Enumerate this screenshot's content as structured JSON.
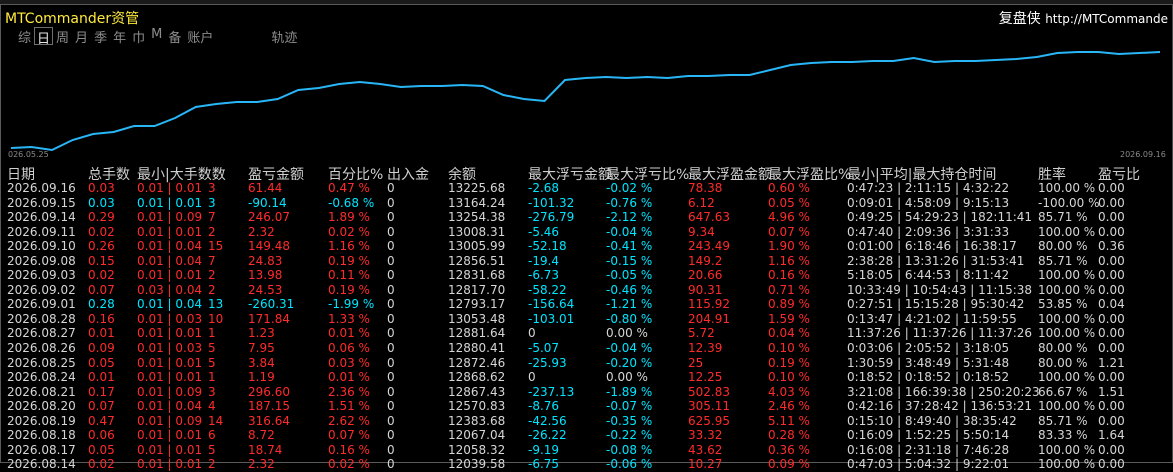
{
  "app": {
    "title": "MTCommander资管",
    "brand": "复盘侠",
    "url": "http://MTCommande"
  },
  "tabs": [
    "综",
    "日",
    "周",
    "月",
    "季",
    "年",
    "巾",
    "M",
    "备",
    "账户",
    "轨迹"
  ],
  "active_tab_index": 1,
  "chart": {
    "start_label": "026.05.25",
    "end_label": "2026.09.16",
    "line_color": "#29b6f6",
    "values": [
      0.02,
      0.03,
      0.0,
      0.1,
      0.16,
      0.18,
      0.24,
      0.24,
      0.32,
      0.43,
      0.46,
      0.48,
      0.48,
      0.51,
      0.6,
      0.62,
      0.66,
      0.68,
      0.66,
      0.63,
      0.64,
      0.64,
      0.65,
      0.64,
      0.55,
      0.51,
      0.49,
      0.7,
      0.72,
      0.73,
      0.72,
      0.73,
      0.72,
      0.74,
      0.74,
      0.75,
      0.75,
      0.8,
      0.85,
      0.87,
      0.88,
      0.88,
      0.89,
      0.89,
      0.92,
      0.88,
      0.89,
      0.89,
      0.9,
      0.91,
      0.93,
      0.97,
      0.98,
      0.98,
      0.96,
      0.97,
      0.98
    ]
  },
  "table": {
    "headers": [
      "日期",
      "总手数",
      "最小|大手数数",
      "盈亏金额",
      "百分比%",
      "出入金",
      "余额",
      "最大浮亏金额",
      "最大浮亏比%",
      "最大浮盈金额",
      "最大浮盈比%",
      "最小|平均|最大持仓时间",
      "胜率",
      "盈亏比"
    ],
    "rows": [
      {
        "date": "2026.09.16",
        "total": "0.03",
        "lots": "0.01 | 0.01",
        "count": "3",
        "pl": "61.44",
        "pct": "0.47 %",
        "inout": "0",
        "balance": "13225.68",
        "float_loss": "-2.68",
        "float_loss_pct": "-0.02 %",
        "float_profit": "78.38",
        "float_profit_pct": "0.60 %",
        "hold": "0:47:23 | 2:11:15 | 4:32:22",
        "win": "100.00 %",
        "ratio": "0.00",
        "sign": "pos"
      },
      {
        "date": "2026.09.15",
        "total": "0.03",
        "lots": "0.01 | 0.01",
        "count": "3",
        "pl": "-90.14",
        "pct": "-0.68 %",
        "inout": "0",
        "balance": "13164.24",
        "float_loss": "-101.32",
        "float_loss_pct": "-0.76 %",
        "float_profit": "6.12",
        "float_profit_pct": "0.05 %",
        "hold": "0:09:01 | 4:58:09 | 9:15:13",
        "win": "-100.00 %",
        "ratio": "0.00",
        "sign": "neg"
      },
      {
        "date": "2026.09.14",
        "total": "0.29",
        "lots": "0.01 | 0.09",
        "count": "7",
        "pl": "246.07",
        "pct": "1.89 %",
        "inout": "0",
        "balance": "13254.38",
        "float_loss": "-276.79",
        "float_loss_pct": "-2.12 %",
        "float_profit": "647.63",
        "float_profit_pct": "4.96 %",
        "hold": "0:49:25 | 54:29:23 | 182:11:41",
        "win": "85.71 %",
        "ratio": "0.00",
        "sign": "pos"
      },
      {
        "date": "2026.09.11",
        "total": "0.02",
        "lots": "0.01 | 0.01",
        "count": "2",
        "pl": "2.32",
        "pct": "0.02 %",
        "inout": "0",
        "balance": "13008.31",
        "float_loss": "-5.46",
        "float_loss_pct": "-0.04 %",
        "float_profit": "9.34",
        "float_profit_pct": "0.07 %",
        "hold": "0:47:40 | 2:09:36 | 3:31:33",
        "win": "100.00 %",
        "ratio": "0.00",
        "sign": "pos"
      },
      {
        "date": "2026.09.10",
        "total": "0.26",
        "lots": "0.01 | 0.04",
        "count": "15",
        "pl": "149.48",
        "pct": "1.16 %",
        "inout": "0",
        "balance": "13005.99",
        "float_loss": "-52.18",
        "float_loss_pct": "-0.41 %",
        "float_profit": "243.49",
        "float_profit_pct": "1.90 %",
        "hold": "0:01:00 | 6:18:46 | 16:38:17",
        "win": "80.00 %",
        "ratio": "0.36",
        "sign": "pos"
      },
      {
        "date": "2026.09.08",
        "total": "0.15",
        "lots": "0.01 | 0.04",
        "count": "7",
        "pl": "24.83",
        "pct": "0.19 %",
        "inout": "0",
        "balance": "12856.51",
        "float_loss": "-19.4",
        "float_loss_pct": "-0.15 %",
        "float_profit": "149.2",
        "float_profit_pct": "1.16 %",
        "hold": "2:38:28 | 13:31:26 | 31:53:41",
        "win": "85.71 %",
        "ratio": "0.00",
        "sign": "pos"
      },
      {
        "date": "2026.09.03",
        "total": "0.02",
        "lots": "0.01 | 0.01",
        "count": "2",
        "pl": "13.98",
        "pct": "0.11 %",
        "inout": "0",
        "balance": "12831.68",
        "float_loss": "-6.73",
        "float_loss_pct": "-0.05 %",
        "float_profit": "20.66",
        "float_profit_pct": "0.16 %",
        "hold": "5:18:05 | 6:44:53 | 8:11:42",
        "win": "100.00 %",
        "ratio": "0.00",
        "sign": "pos"
      },
      {
        "date": "2026.09.02",
        "total": "0.07",
        "lots": "0.03 | 0.04",
        "count": "2",
        "pl": "24.53",
        "pct": "0.19 %",
        "inout": "0",
        "balance": "12817.70",
        "float_loss": "-58.22",
        "float_loss_pct": "-0.46 %",
        "float_profit": "90.31",
        "float_profit_pct": "0.71 %",
        "hold": "10:33:49 | 10:54:43 | 11:15:38",
        "win": "100.00 %",
        "ratio": "0.00",
        "sign": "pos"
      },
      {
        "date": "2026.09.01",
        "total": "0.28",
        "lots": "0.01 | 0.04",
        "count": "13",
        "pl": "-260.31",
        "pct": "-1.99 %",
        "inout": "0",
        "balance": "12793.17",
        "float_loss": "-156.64",
        "float_loss_pct": "-1.21 %",
        "float_profit": "115.92",
        "float_profit_pct": "0.89 %",
        "hold": "0:27:51 | 15:15:28 | 95:30:42",
        "win": "53.85 %",
        "ratio": "0.04",
        "sign": "neg"
      },
      {
        "date": "2026.08.28",
        "total": "0.16",
        "lots": "0.01 | 0.03",
        "count": "10",
        "pl": "171.84",
        "pct": "1.33 %",
        "inout": "0",
        "balance": "13053.48",
        "float_loss": "-103.01",
        "float_loss_pct": "-0.80 %",
        "float_profit": "204.91",
        "float_profit_pct": "1.59 %",
        "hold": "0:13:47 | 4:21:02 | 11:59:55",
        "win": "100.00 %",
        "ratio": "0.00",
        "sign": "pos"
      },
      {
        "date": "2026.08.27",
        "total": "0.01",
        "lots": "0.01 | 0.01",
        "count": "1",
        "pl": "1.23",
        "pct": "0.01 %",
        "inout": "0",
        "balance": "12881.64",
        "float_loss": "0",
        "float_loss_pct": "0.00 %",
        "float_profit": "5.72",
        "float_profit_pct": "0.04 %",
        "hold": "11:37:26 | 11:37:26 | 11:37:26",
        "win": "100.00 %",
        "ratio": "0.00",
        "sign": "pos"
      },
      {
        "date": "2026.08.26",
        "total": "0.09",
        "lots": "0.01 | 0.03",
        "count": "5",
        "pl": "7.95",
        "pct": "0.06 %",
        "inout": "0",
        "balance": "12880.41",
        "float_loss": "-5.07",
        "float_loss_pct": "-0.04 %",
        "float_profit": "12.39",
        "float_profit_pct": "0.10 %",
        "hold": "0:03:06 | 2:05:52 | 3:18:05",
        "win": "80.00 %",
        "ratio": "0.00",
        "sign": "pos"
      },
      {
        "date": "2026.08.25",
        "total": "0.05",
        "lots": "0.01 | 0.01",
        "count": "5",
        "pl": "3.84",
        "pct": "0.03 %",
        "inout": "0",
        "balance": "12872.46",
        "float_loss": "-25.93",
        "float_loss_pct": "-0.20 %",
        "float_profit": "25",
        "float_profit_pct": "0.19 %",
        "hold": "1:30:59 | 3:48:49 | 5:31:48",
        "win": "80.00 %",
        "ratio": "1.21",
        "sign": "pos"
      },
      {
        "date": "2026.08.24",
        "total": "0.01",
        "lots": "0.01 | 0.01",
        "count": "1",
        "pl": "1.19",
        "pct": "0.01 %",
        "inout": "0",
        "balance": "12868.62",
        "float_loss": "0",
        "float_loss_pct": "0.00 %",
        "float_profit": "12.25",
        "float_profit_pct": "0.10 %",
        "hold": "0:18:52 | 0:18:52 | 0:18:52",
        "win": "100.00 %",
        "ratio": "0.00",
        "sign": "pos"
      },
      {
        "date": "2026.08.21",
        "total": "0.17",
        "lots": "0.01 | 0.09",
        "count": "3",
        "pl": "296.60",
        "pct": "2.36 %",
        "inout": "0",
        "balance": "12867.43",
        "float_loss": "-237.13",
        "float_loss_pct": "-1.89 %",
        "float_profit": "502.83",
        "float_profit_pct": "4.03 %",
        "hold": "3:21:08 | 166:39:38 | 250:20:23",
        "win": "66.67 %",
        "ratio": "1.51",
        "sign": "pos"
      },
      {
        "date": "2026.08.20",
        "total": "0.07",
        "lots": "0.01 | 0.04",
        "count": "4",
        "pl": "187.15",
        "pct": "1.51 %",
        "inout": "0",
        "balance": "12570.83",
        "float_loss": "-8.76",
        "float_loss_pct": "-0.07 %",
        "float_profit": "305.11",
        "float_profit_pct": "2.46 %",
        "hold": "0:42:16 | 37:28:42 | 136:53:21",
        "win": "100.00 %",
        "ratio": "0.00",
        "sign": "pos"
      },
      {
        "date": "2026.08.19",
        "total": "0.47",
        "lots": "0.01 | 0.09",
        "count": "14",
        "pl": "316.64",
        "pct": "2.62 %",
        "inout": "0",
        "balance": "12383.68",
        "float_loss": "-42.56",
        "float_loss_pct": "-0.35 %",
        "float_profit": "625.95",
        "float_profit_pct": "5.11 %",
        "hold": "0:15:10 | 8:49:40 | 38:35:42",
        "win": "85.71 %",
        "ratio": "0.00",
        "sign": "pos"
      },
      {
        "date": "2026.08.18",
        "total": "0.06",
        "lots": "0.01 | 0.01",
        "count": "6",
        "pl": "8.72",
        "pct": "0.07 %",
        "inout": "0",
        "balance": "12067.04",
        "float_loss": "-26.22",
        "float_loss_pct": "-0.22 %",
        "float_profit": "33.32",
        "float_profit_pct": "0.28 %",
        "hold": "0:16:09 | 1:52:25 | 5:50:14",
        "win": "83.33 %",
        "ratio": "1.64",
        "sign": "pos"
      },
      {
        "date": "2026.08.17",
        "total": "0.05",
        "lots": "0.01 | 0.01",
        "count": "5",
        "pl": "18.74",
        "pct": "0.16 %",
        "inout": "0",
        "balance": "12058.32",
        "float_loss": "-9.19",
        "float_loss_pct": "-0.08 %",
        "float_profit": "43.62",
        "float_profit_pct": "0.36 %",
        "hold": "0:16:08 | 2:31:18 | 7:46:28",
        "win": "100.00 %",
        "ratio": "0.00",
        "sign": "pos"
      },
      {
        "date": "2026.08.14",
        "total": "0.02",
        "lots": "0.01 | 0.01",
        "count": "2",
        "pl": "2.32",
        "pct": "0.02 %",
        "inout": "0",
        "balance": "12039.58",
        "float_loss": "-6.75",
        "float_loss_pct": "-0.06 %",
        "float_profit": "10.27",
        "float_profit_pct": "0.09 %",
        "hold": "0:47:03 | 5:04:32 | 9:22:01",
        "win": "100.00 %",
        "ratio": "0.00",
        "sign": "pos"
      }
    ]
  }
}
